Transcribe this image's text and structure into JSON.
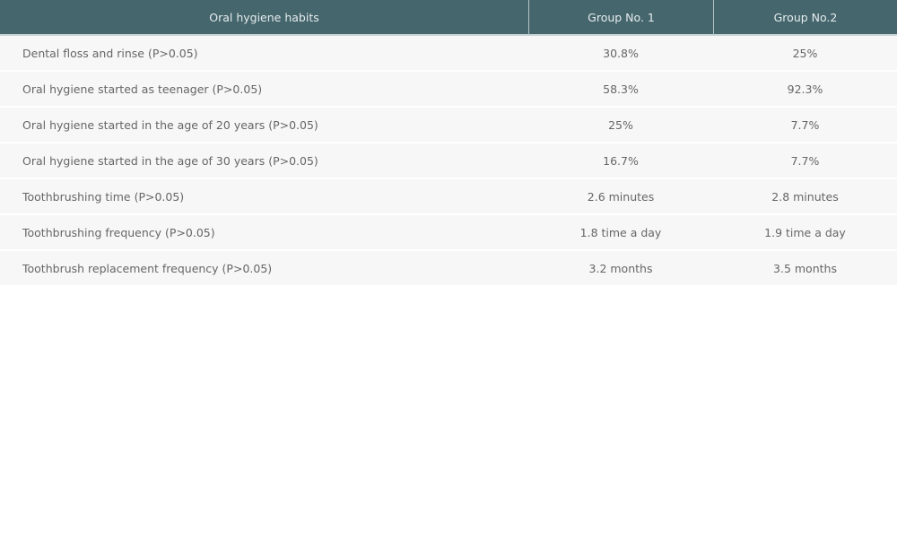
{
  "table": {
    "headers": [
      "Oral hygiene habits",
      "Group No. 1",
      "Group No.2"
    ],
    "rows": [
      {
        "habit": "Dental floss and rinse (P>0.05)",
        "group1": "30.8%",
        "group2": "25%"
      },
      {
        "habit": "Oral hygiene started as teenager (P>0.05)",
        "group1": "58.3%",
        "group2": "92.3%"
      },
      {
        "habit": "Oral hygiene started in the age of 20 years (P>0.05)",
        "group1": "25%",
        "group2": "7.7%"
      },
      {
        "habit": "Oral hygiene started in the age of 30 years (P>0.05)",
        "group1": "16.7%",
        "group2": "7.7%"
      },
      {
        "habit": "Toothbrushing time (P>0.05)",
        "group1": "2.6 minutes",
        "group2": "2.8 minutes"
      },
      {
        "habit": "Toothbrushing frequency (P>0.05)",
        "group1": "1.8 time a day",
        "group2": "1.9 time a day"
      },
      {
        "habit": "Toothbrush replacement frequency (P>0.05)",
        "group1": "3.2 months",
        "group2": "3.5 months"
      }
    ]
  },
  "colors": {
    "header_bg": "#45666d",
    "row_bg": "#f7f7f7",
    "text": "#666666"
  }
}
